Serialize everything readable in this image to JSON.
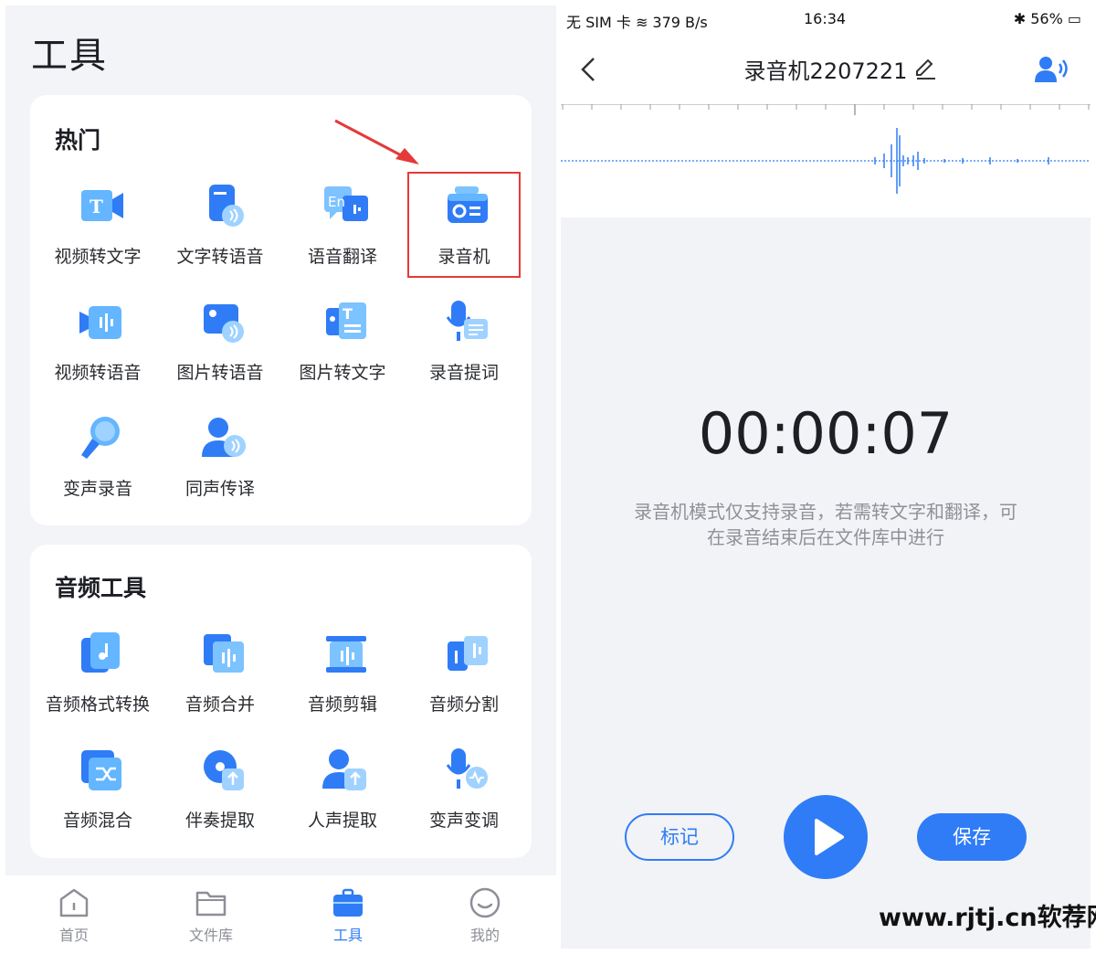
{
  "left": {
    "title": "工具",
    "hot": {
      "title": "热门",
      "items": [
        {
          "label": "视频转文字",
          "icon": "video-to-text-icon"
        },
        {
          "label": "文字转语音",
          "icon": "text-to-speech-icon"
        },
        {
          "label": "语音翻译",
          "icon": "voice-translate-icon"
        },
        {
          "label": "录音机",
          "icon": "recorder-icon"
        },
        {
          "label": "视频转语音",
          "icon": "video-to-audio-icon"
        },
        {
          "label": "图片转语音",
          "icon": "image-to-speech-icon"
        },
        {
          "label": "图片转文字",
          "icon": "image-to-text-icon"
        },
        {
          "label": "录音提词",
          "icon": "teleprompter-icon"
        },
        {
          "label": "变声录音",
          "icon": "voice-changer-mic-icon"
        },
        {
          "label": "同声传译",
          "icon": "simultaneous-interpret-icon"
        }
      ]
    },
    "audio": {
      "title": "音频工具",
      "items": [
        {
          "label": "音频格式转换",
          "icon": "audio-format-convert-icon"
        },
        {
          "label": "音频合并",
          "icon": "audio-merge-icon"
        },
        {
          "label": "音频剪辑",
          "icon": "audio-cut-icon"
        },
        {
          "label": "音频分割",
          "icon": "audio-split-icon"
        },
        {
          "label": "音频混合",
          "icon": "audio-mix-icon"
        },
        {
          "label": "伴奏提取",
          "icon": "accompaniment-extract-icon"
        },
        {
          "label": "人声提取",
          "icon": "vocal-extract-icon"
        },
        {
          "label": "变声变调",
          "icon": "pitch-change-icon"
        }
      ]
    },
    "tabs": [
      {
        "label": "首页",
        "icon": "home-icon"
      },
      {
        "label": "文件库",
        "icon": "folder-icon"
      },
      {
        "label": "工具",
        "icon": "toolbox-icon"
      },
      {
        "label": "我的",
        "icon": "profile-icon"
      }
    ],
    "active_tab": 2
  },
  "right": {
    "status": {
      "left": "无 SIM 卡 ≋ 379 B/s",
      "time": "16:34",
      "right": "✱ 56% ▭"
    },
    "title": "录音机2207221",
    "timer": "00:00:07",
    "hint": "录音机模式仅支持录音，若需转文字和翻译，可在录音结束后在文件库中进行",
    "mark_label": "标记",
    "save_label": "保存"
  },
  "watermark": "www.rjtj.cn软荐网",
  "colors": {
    "accent": "#2f7cf6",
    "highlight": "#e53a3a",
    "panel_bg": "#f3f4f8"
  }
}
